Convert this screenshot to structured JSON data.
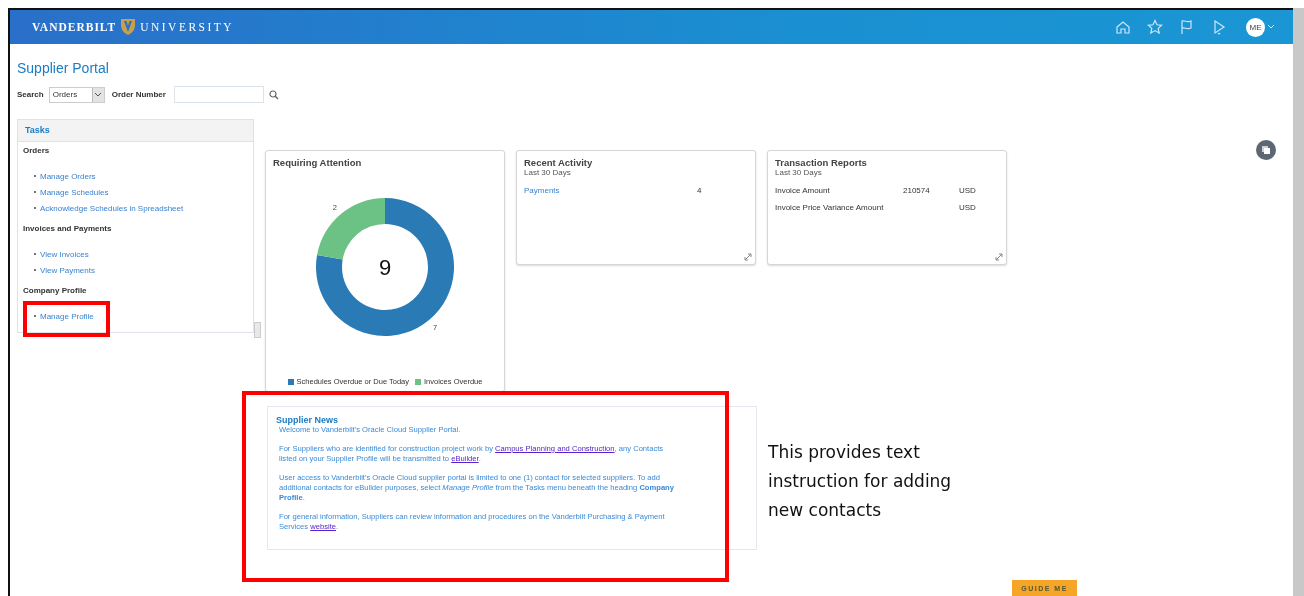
{
  "header": {
    "brand_left": "VANDERBILT",
    "brand_right": "UNIVERSITY",
    "avatar": "ME"
  },
  "page_title": "Supplier Portal",
  "search": {
    "label": "Search",
    "scope": "Orders",
    "field_label": "Order Number"
  },
  "tasks": {
    "title": "Tasks",
    "groups": [
      {
        "heading": "Orders",
        "items": [
          "Manage Orders",
          "Manage Schedules",
          "Acknowledge Schedules in Spreadsheet"
        ]
      },
      {
        "heading": "Invoices and Payments",
        "items": [
          "View Invoices",
          "View Payments"
        ]
      },
      {
        "heading": "Company Profile",
        "items": [
          "Manage Profile"
        ]
      }
    ]
  },
  "requiring_attention": {
    "title": "Requiring Attention",
    "total": "9",
    "chart_data": {
      "type": "donut",
      "categories": [
        "Schedules Overdue or Due Today",
        "Invoices Overdue"
      ],
      "values": [
        7,
        2
      ],
      "colors": [
        "#2a7ab5",
        "#6cc185"
      ],
      "data_labels": true
    }
  },
  "recent_activity": {
    "title": "Recent Activity",
    "subtitle": "Last 30 Days",
    "rows": [
      {
        "label": "Payments",
        "value": "4"
      }
    ]
  },
  "transaction_reports": {
    "title": "Transaction Reports",
    "subtitle": "Last 30 Days",
    "rows": [
      {
        "label": "Invoice Amount",
        "value": "210574",
        "currency": "USD"
      },
      {
        "label": "Invoice Price Variance Amount",
        "currency": "USD"
      }
    ]
  },
  "supplier_news": {
    "title": "Supplier News",
    "paragraphs": [
      [
        {
          "text": "Welcome to Vanderbilt's Oracle Cloud Supplier Portal."
        }
      ],
      [
        {
          "text": "For Suppliers who are identified for construction project work by "
        },
        {
          "link": "Campus Planning and Construction"
        },
        {
          "text": ", any Contacts listed on your Supplier Profile will be transmitted to "
        },
        {
          "link": "eBuilder"
        },
        {
          "text": "."
        }
      ],
      [
        {
          "text": "User access to Vanderbilt's Oracle Cloud supplier portal is limited to one (1) contact for selected suppliers. To add additional contacts for eBuilder purposes, select *Manage Profile* from the Tasks menu beneath the heading **Company Profile**."
        }
      ],
      [
        {
          "text": "For general information, Suppliers can review information and procedures on the Vanderbilt Purchasing & Payment Services "
        },
        {
          "link": "website"
        },
        {
          "text": "."
        }
      ]
    ]
  },
  "annotation": {
    "text": "This provides text instruction for adding new contacts"
  },
  "guide_button": "GUIDE ME"
}
